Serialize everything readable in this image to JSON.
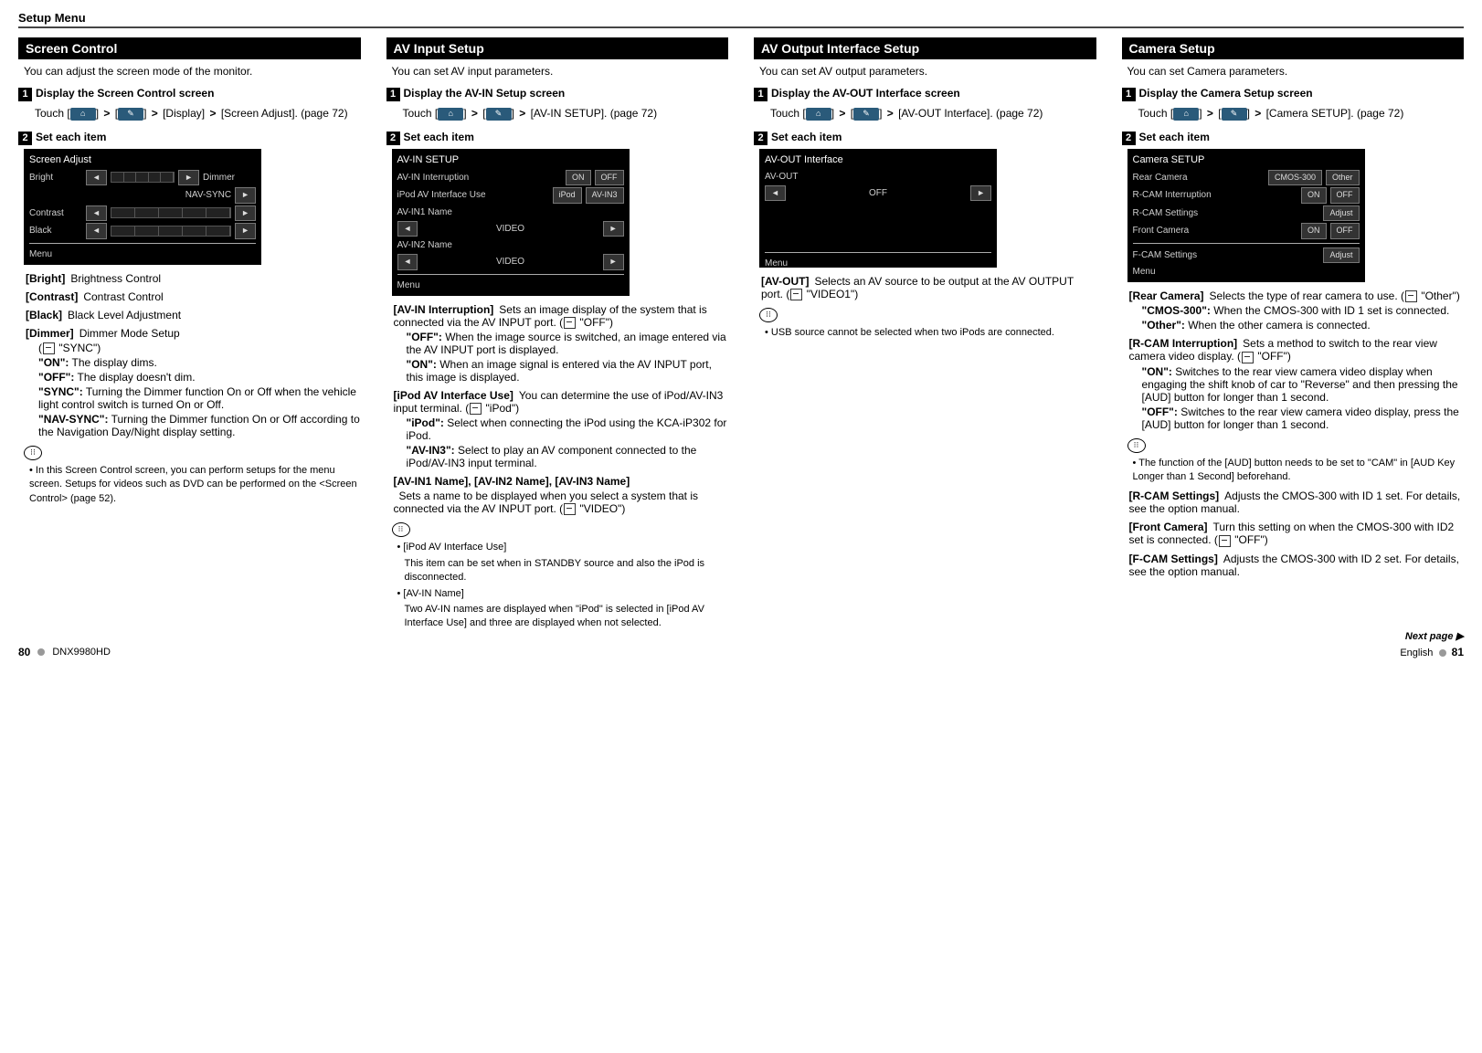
{
  "header": {
    "title": "Setup Menu"
  },
  "col1": {
    "heading": "Screen Control",
    "intro": "You can adjust the screen mode of the monitor.",
    "step1_label": "Display the Screen Control screen",
    "touch_pre": "Touch [",
    "touch_mid": "] ",
    "display": "[Display]",
    "screen_adjust": "[Screen Adjust]. (page 72)",
    "step2_label": "Set each item",
    "img": {
      "title": "Screen Adjust",
      "bright": "Bright",
      "dimmer": "Dimmer",
      "nav": "NAV-SYNC",
      "contrast": "Contrast",
      "black": "Black",
      "menu": "Menu"
    },
    "defs": {
      "bright_t": "[Bright]",
      "bright_d": "Brightness Control",
      "contrast_t": "[Contrast]",
      "contrast_d": "Contrast Control",
      "black_t": "[Black]",
      "black_d": "Black Level Adjustment",
      "dimmer_t": "[Dimmer]",
      "dimmer_d": "Dimmer Mode Setup",
      "dimmer_default": "\"SYNC\")",
      "on_k": "\"ON\":",
      "on_v": "The display dims.",
      "off_k": "\"OFF\":",
      "off_v": "The display doesn't dim.",
      "sync_k": "\"SYNC\":",
      "sync_v": "Turning the Dimmer function On or Off when the vehicle light control switch is turned On or Off.",
      "nav_k": "\"NAV-SYNC\":",
      "nav_v": "Turning the Dimmer function On or Off according to the Navigation Day/Night display setting."
    },
    "note": "In this Screen Control screen, you can perform setups for the menu screen. Setups for videos such as DVD can be performed on the <Screen Control> (page 52)."
  },
  "col2": {
    "heading": "AV Input Setup",
    "intro": "You can set AV input parameters.",
    "step1_label": "Display the AV-IN Setup screen",
    "touch_tail": "[AV-IN SETUP]. (page 72)",
    "step2_label": "Set each item",
    "img": {
      "title": "AV-IN SETUP",
      "l1": "AV-IN Interruption",
      "on": "ON",
      "off": "OFF",
      "l2": "iPod AV Interface Use",
      "ipod": "iPod",
      "avin3": "AV-IN3",
      "l3": "AV-IN1 Name",
      "video": "VIDEO",
      "l4": "AV-IN2 Name",
      "menu": "Menu"
    },
    "defs": {
      "int_t": "[AV-IN Interruption]",
      "int_d": "Sets an image display of the system that is connected via the AV INPUT port. (",
      "int_def": "\"OFF\")",
      "int_off_k": "\"OFF\":",
      "int_off_v": "When the image source is switched, an image entered via the AV INPUT port is displayed.",
      "int_on_k": "\"ON\":",
      "int_on_v": "When an image signal is entered via the AV INPUT port, this image is displayed.",
      "use_t": "[iPod AV Interface Use]",
      "use_d": "You can determine the use of iPod/AV-IN3 input terminal. (",
      "use_def": "\"iPod\")",
      "use_ipod_k": "\"iPod\":",
      "use_ipod_v": "Select when connecting the iPod using the KCA-iP302 for iPod.",
      "use_av3_k": "\"AV-IN3\":",
      "use_av3_v": "Select to play an AV component connected to the iPod/AV-IN3 input terminal.",
      "name_t": "[AV-IN1 Name], [AV-IN2 Name], [AV-IN3 Name]",
      "name_d": "Sets a name to be displayed when you select a system that is connected via the AV INPUT port. (",
      "name_def": "\"VIDEO\")"
    },
    "notes": {
      "n1_t": "[iPod AV Interface Use]",
      "n1_b": "This item can be set when in STANDBY source and also the iPod is disconnected.",
      "n2_t": "[AV-IN Name]",
      "n2_b": "Two AV-IN names are displayed when \"iPod\" is selected in [iPod AV Interface Use] and three are displayed when not selected."
    }
  },
  "col3": {
    "heading": "AV Output Interface Setup",
    "intro": "You can set AV output parameters.",
    "step1_label": "Display the AV-OUT Interface screen",
    "touch_tail": "[AV-OUT Interface]. (page 72)",
    "step2_label": "Set each item",
    "img": {
      "title": "AV-OUT Interface",
      "row": "AV-OUT",
      "val": "OFF",
      "menu": "Menu"
    },
    "defs": {
      "out_t": "[AV-OUT]",
      "out_d": "Selects an AV source to be output at the AV OUTPUT port. (",
      "out_def": "\"VIDEO1\")"
    },
    "note": "USB source cannot be selected when two iPods are connected."
  },
  "col4": {
    "heading": "Camera Setup",
    "intro": "You can set Camera parameters.",
    "step1_label": "Display the Camera Setup screen",
    "touch_tail": "[Camera SETUP]. (page 72)",
    "step2_label": "Set each item",
    "img": {
      "title": "Camera SETUP",
      "r1": "Rear Camera",
      "b1a": "CMOS-300",
      "b1b": "Other",
      "r2": "R-CAM Interruption",
      "on": "ON",
      "off": "OFF",
      "r3": "R-CAM Settings",
      "adj": "Adjust",
      "r4": "Front Camera",
      "r5": "F-CAM Settings",
      "menu": "Menu"
    },
    "defs": {
      "rc_t": "[Rear Camera]",
      "rc_d": "Selects the type of rear camera to use. (",
      "rc_def": "\"Other\")",
      "rc_c_k": "\"CMOS-300\":",
      "rc_c_v": "When the CMOS-300 with ID 1 set is connected.",
      "rc_o_k": "\"Other\":",
      "rc_o_v": "When the other camera is connected.",
      "ri_t": "[R-CAM Interruption]",
      "ri_d": "Sets a method to switch to the rear view camera video display. (",
      "ri_def": "\"OFF\")",
      "ri_on_k": "\"ON\":",
      "ri_on_v": "Switches to the rear view camera video display when engaging the shift knob of car to \"Reverse\" and then pressing the [AUD] button for longer than 1 second.",
      "ri_off_k": "\"OFF\":",
      "ri_off_v": "Switches to the rear view camera video display, press the [AUD] button for longer than 1 second.",
      "ri_note": "The function of the [AUD] button needs to be set to \"CAM\" in [AUD Key Longer than 1 Second] beforehand.",
      "rs_t": "[R-CAM Settings]",
      "rs_d": "Adjusts the CMOS-300 with ID 1 set. For details, see the option manual.",
      "fc_t": "[Front Camera]",
      "fc_d": "Turn this setting on when the CMOS-300 with ID2 set is connected. (",
      "fc_def": "\"OFF\")",
      "fs_t": "[F-CAM Settings]",
      "fs_d": "Adjusts the CMOS-300 with ID 2 set. For details, see the option manual."
    }
  },
  "footer": {
    "left_page": "80",
    "model": "DNX9980HD",
    "next": "Next page ▶",
    "english": "English",
    "right_page": "81"
  },
  "touch_word": "Touch ["
}
